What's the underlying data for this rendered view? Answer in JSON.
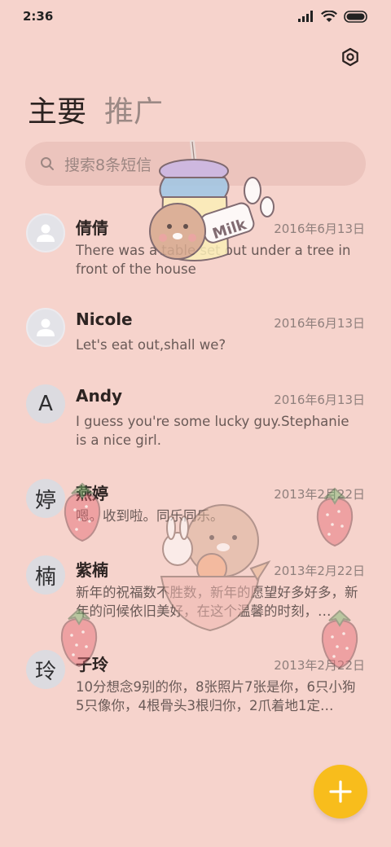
{
  "status": {
    "time": "2:36"
  },
  "tabs": [
    {
      "label": "主要"
    },
    {
      "label": "推广"
    }
  ],
  "search": {
    "placeholder": "搜索8条短信"
  },
  "conversations": [
    {
      "avatar": "",
      "avatar_icon": "person-icon",
      "name": "倩倩",
      "date": "2016年6月13日",
      "snippet": "There was a table set out under a tree in front of the house"
    },
    {
      "avatar": "",
      "avatar_icon": "person-icon",
      "name": "Nicole",
      "date": "2016年6月13日",
      "snippet": "Let's eat out,shall we?"
    },
    {
      "avatar": "A",
      "name": "Andy",
      "date": "2016年6月13日",
      "snippet": "I guess you're some lucky guy.Stephanie is a nice girl."
    },
    {
      "avatar": "婷",
      "name": "燕婷",
      "date": "2013年2月22日",
      "snippet": "嗯。收到啦。同乐同乐。"
    },
    {
      "avatar": "楠",
      "name": "紫楠",
      "date": "2013年2月22日",
      "snippet": "新年的祝福数不胜数，新年的愿望好多好多，新年的问候依旧美好，在这个温馨的时刻，…"
    },
    {
      "avatar": "玲",
      "name": "子玲",
      "date": "2013年2月22日",
      "snippet": "10分想念9别的你，8张照片7张是你，6只小狗5只像你，4根骨头3根归你，2爪着地1定…"
    }
  ],
  "decorations": {
    "milk_label": "Milk"
  },
  "colors": {
    "background": "#f6d3cc",
    "fab": "#f8bd1c",
    "search_bg": "#ecc4bd"
  }
}
